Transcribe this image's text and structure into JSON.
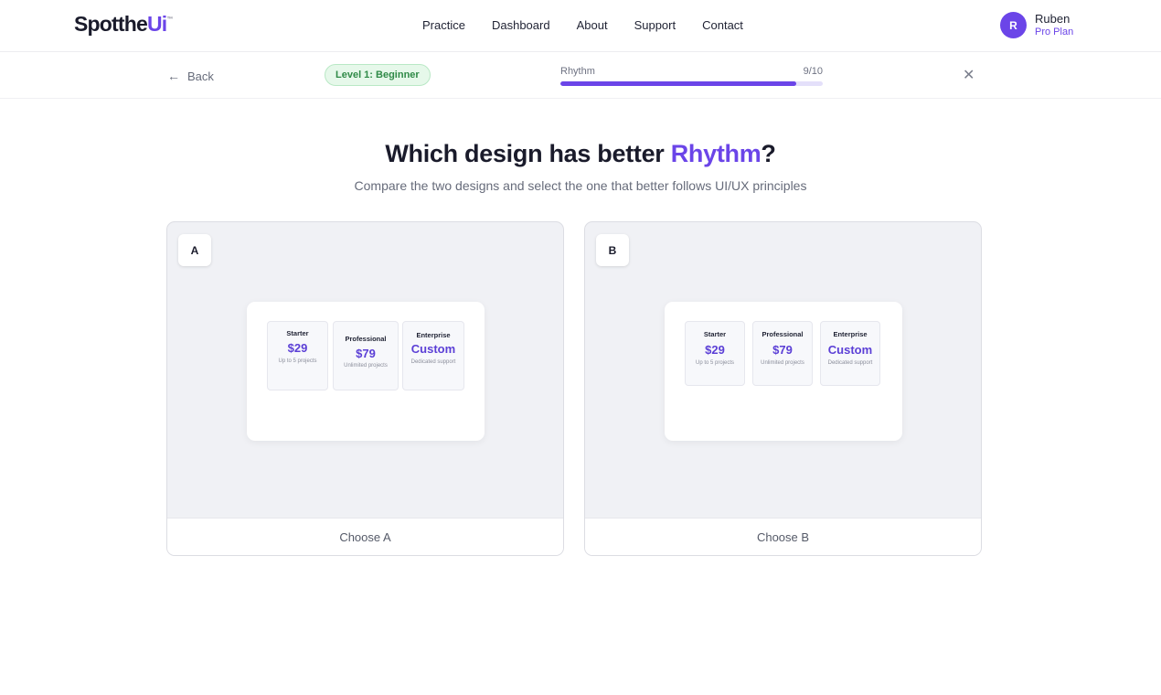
{
  "header": {
    "logo_main": "Spotthe",
    "logo_accent": "Ui",
    "logo_mark": "™",
    "nav": [
      "Practice",
      "Dashboard",
      "About",
      "Support",
      "Contact"
    ],
    "user": {
      "initial": "R",
      "name": "Ruben",
      "plan": "Pro Plan"
    }
  },
  "subbar": {
    "back_label": "Back",
    "back_icon": "arrow-left-icon",
    "level": "Level 1: Beginner",
    "progress_label": "Rhythm",
    "progress_count": "9/10",
    "progress_fraction": 0.9,
    "close_icon": "close-icon"
  },
  "question": {
    "title_prefix": "Which design has better ",
    "title_accent": "Rhythm",
    "title_suffix": "?",
    "subtitle": "Compare the two designs and select the one that better follows UI/UX principles"
  },
  "options": {
    "a": {
      "badge": "A",
      "choose": "Choose A",
      "plans": [
        {
          "name": "Starter",
          "price": "$29",
          "desc": "Up to 5 projects"
        },
        {
          "name": "Professional",
          "price": "$79",
          "desc": "Unlimited projects"
        },
        {
          "name": "Enterprise",
          "price": "Custom",
          "desc": "Dedicated support"
        }
      ]
    },
    "b": {
      "badge": "B",
      "choose": "Choose B",
      "plans": [
        {
          "name": "Starter",
          "price": "$29",
          "desc": "Up to 5 projects"
        },
        {
          "name": "Professional",
          "price": "$79",
          "desc": "Unlimited projects"
        },
        {
          "name": "Enterprise",
          "price": "Custom",
          "desc": "Dedicated support"
        }
      ]
    }
  },
  "colors": {
    "accent": "#6b45e8",
    "level_bg": "#e6f8ea",
    "level_text": "#2f8a47"
  }
}
